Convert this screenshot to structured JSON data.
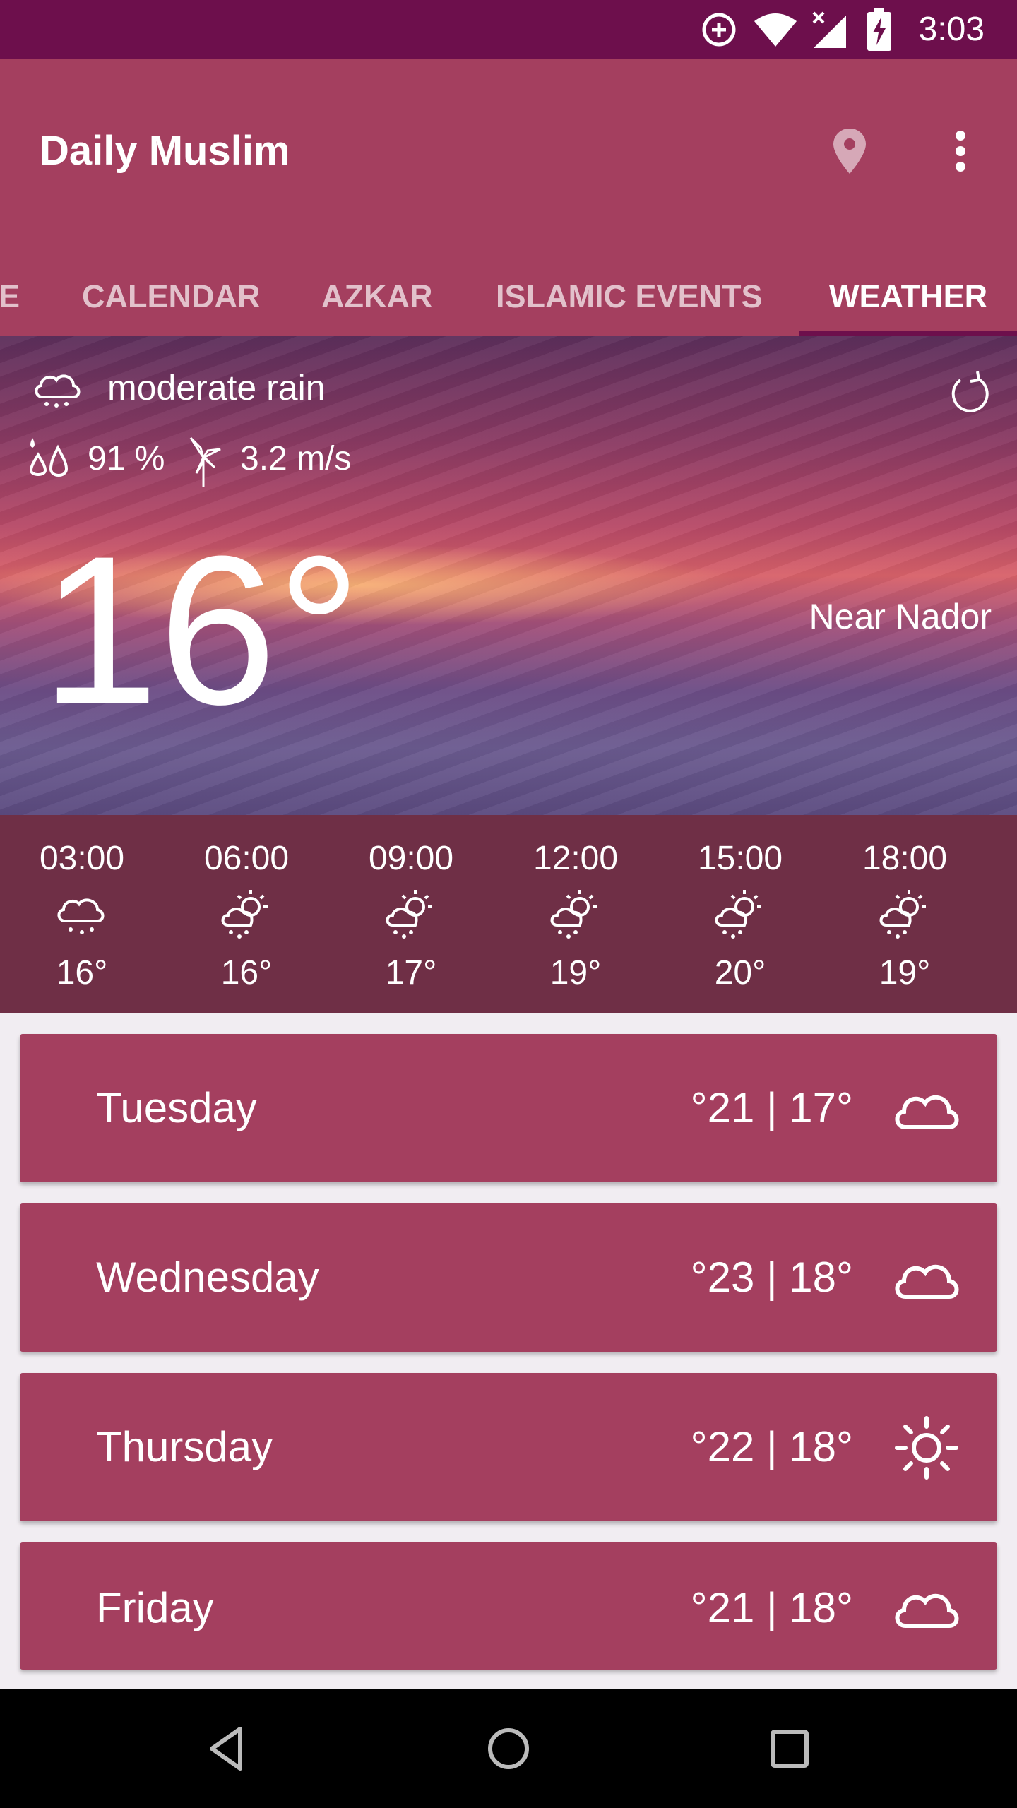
{
  "status_bar": {
    "time": "3:03",
    "icons": [
      "data-saver-icon",
      "wifi-icon",
      "signal-icon",
      "battery-charging-icon"
    ]
  },
  "app_bar": {
    "title": "Daily Muslim",
    "actions": [
      "location-pin-icon",
      "more-vert-icon"
    ]
  },
  "tabs": [
    {
      "label": "E",
      "active": false
    },
    {
      "label": "CALENDAR",
      "active": false
    },
    {
      "label": "AZKAR",
      "active": false
    },
    {
      "label": "ISLAMIC EVENTS",
      "active": false
    },
    {
      "label": "WEATHER",
      "active": true
    }
  ],
  "current": {
    "condition": "moderate rain",
    "condition_icon": "rain-cloud-icon",
    "humidity": "91 %",
    "wind": "3.2 m/s",
    "temperature": "16°",
    "location": "Near Nador"
  },
  "hourly": [
    {
      "time": "03:00",
      "temp": "16°",
      "icon": "rain-cloud-icon"
    },
    {
      "time": "06:00",
      "temp": "16°",
      "icon": "sun-rain-icon"
    },
    {
      "time": "09:00",
      "temp": "17°",
      "icon": "sun-rain-icon"
    },
    {
      "time": "12:00",
      "temp": "19°",
      "icon": "sun-rain-icon"
    },
    {
      "time": "15:00",
      "temp": "20°",
      "icon": "sun-rain-icon"
    },
    {
      "time": "18:00",
      "temp": "19°",
      "icon": "sun-rain-icon"
    }
  ],
  "daily": [
    {
      "day": "Tuesday",
      "temps": "°21 | 17°",
      "icon": "cloud-icon"
    },
    {
      "day": "Wednesday",
      "temps": "°23 | 18°",
      "icon": "cloud-icon"
    },
    {
      "day": "Thursday",
      "temps": "°22 | 18°",
      "icon": "sun-icon"
    },
    {
      "day": "Friday",
      "temps": "°21 | 18°",
      "icon": "cloud-icon"
    }
  ],
  "colors": {
    "status_bar": "#6d0f4c",
    "primary": "#a43f5f",
    "hourly_bg": "#6f2f46",
    "list_bg": "#f1edf2"
  }
}
